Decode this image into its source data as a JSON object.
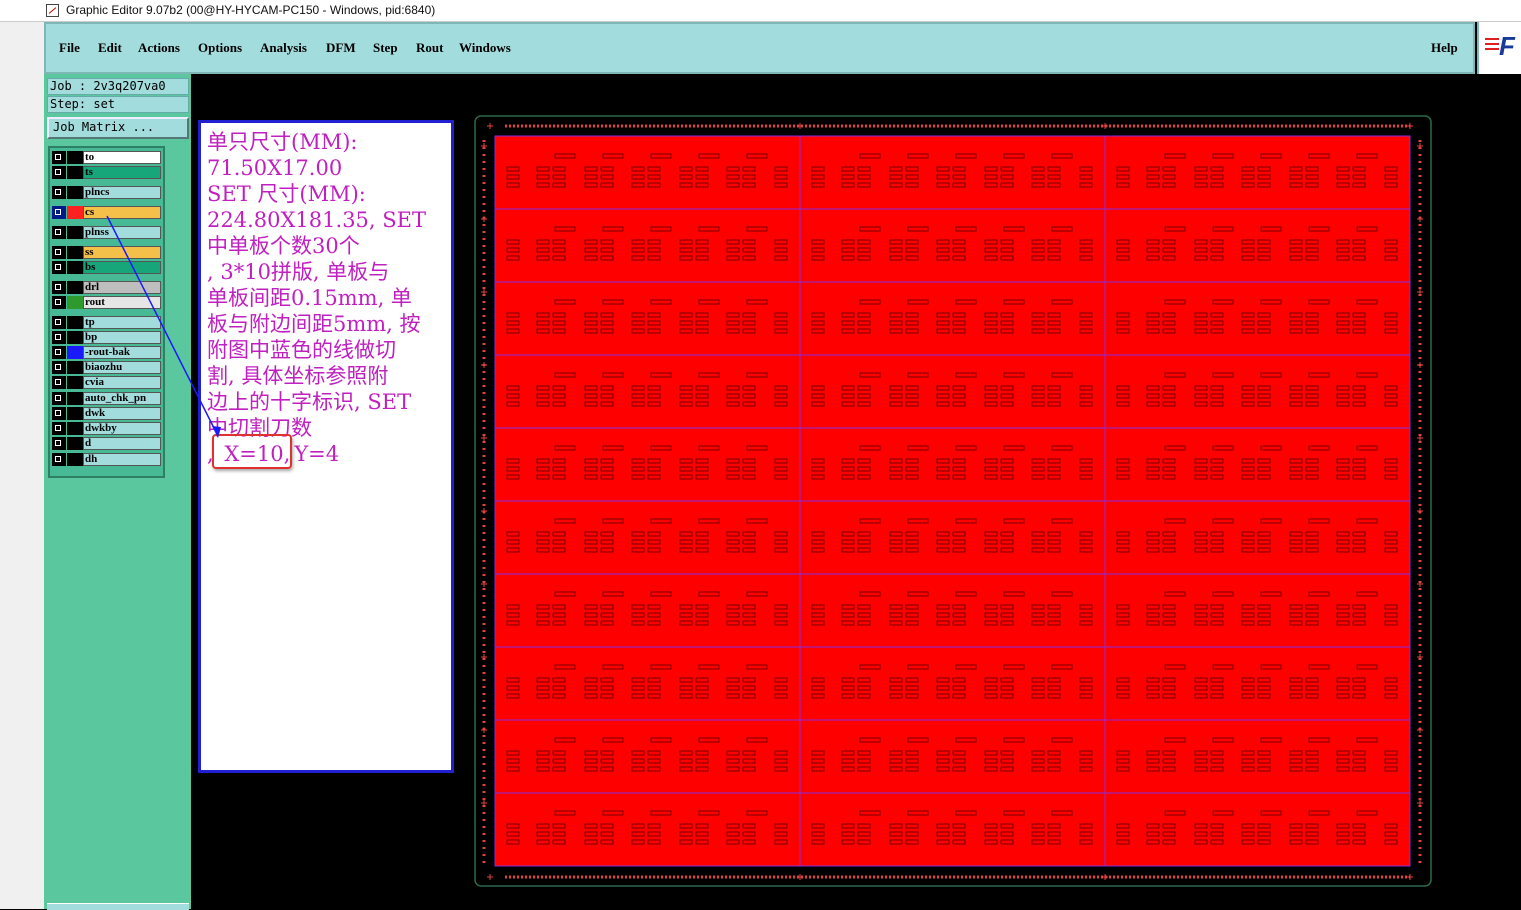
{
  "window": {
    "title": "Graphic Editor 9.07b2 (00@HY-HYCAM-PC150 - Windows, pid:6840)"
  },
  "menu": {
    "items": [
      "File",
      "Edit",
      "Actions",
      "Options",
      "Analysis",
      "DFM",
      "Step",
      "Rout",
      "Windows"
    ],
    "help": "Help"
  },
  "logo": {
    "text": "F"
  },
  "job": {
    "job_line": "Job : 2v3q207va0",
    "step_line": "Step: set",
    "matrix_button": "Job Matrix ..."
  },
  "layers": [
    {
      "name": "to",
      "bg": "#ffffff",
      "swatch": "#000000"
    },
    {
      "name": "ts",
      "bg": "#17a67a",
      "swatch": "#000000"
    },
    {
      "name": "plncs",
      "bg": "#a3dcdc",
      "swatch": "#000000"
    },
    {
      "name": "cs",
      "bg": "#f5c04a",
      "swatch": "#ff2020",
      "active": true
    },
    {
      "name": "plnss",
      "bg": "#a3dcdc",
      "swatch": "#000000"
    },
    {
      "name": "ss",
      "bg": "#f5c04a",
      "swatch": "#000000"
    },
    {
      "name": "bs",
      "bg": "#17a67a",
      "swatch": "#000000"
    },
    {
      "name": "drl",
      "bg": "#bebebe",
      "swatch": "#000000"
    },
    {
      "name": "rout",
      "bg": "#e6e6e6",
      "swatch": "#2e9a2e"
    },
    {
      "name": "tp",
      "bg": "#a3dcdc",
      "swatch": "#000000"
    },
    {
      "name": "bp",
      "bg": "#a3dcdc",
      "swatch": "#000000"
    },
    {
      "name": "-rout-bak",
      "bg": "#a3dcdc",
      "swatch": "#1a1aff"
    },
    {
      "name": "biaozhu",
      "bg": "#a3dcdc",
      "swatch": "#000000"
    },
    {
      "name": "cvia",
      "bg": "#a3dcdc",
      "swatch": "#000000"
    },
    {
      "name": "auto_chk_pn",
      "bg": "#a3dcdc",
      "swatch": "#000000"
    },
    {
      "name": "dwk",
      "bg": "#a3dcdc",
      "swatch": "#000000"
    },
    {
      "name": "dwkby",
      "bg": "#a3dcdc",
      "swatch": "#000000"
    },
    {
      "name": "d",
      "bg": "#a3dcdc",
      "swatch": "#000000"
    },
    {
      "name": "dh",
      "bg": "#a3dcdc",
      "swatch": "#000000"
    }
  ],
  "annotation": {
    "lines": [
      "单只尺寸(MM):",
      "71.50X17.00",
      "SET 尺寸(MM):",
      "224.80X181.35, SET",
      "中单板个数30个",
      ", 3*10拼版, 单板与",
      "单板间距0.15mm, 单",
      "板与附边间距5mm, 按",
      "附图中蓝色的线做切",
      "割, 具体坐标参照附",
      "边上的十字标识, SET",
      "中切割刀数"
    ],
    "last_prefix": ", ",
    "x_value": "X=10,",
    "y_value": "Y=4"
  },
  "colors": {
    "board": "#ff0000",
    "frame": "#e64040",
    "cut_lines": "#8a2be2",
    "annotation_text": "#c020c0",
    "arrow": "#1a1aff"
  }
}
